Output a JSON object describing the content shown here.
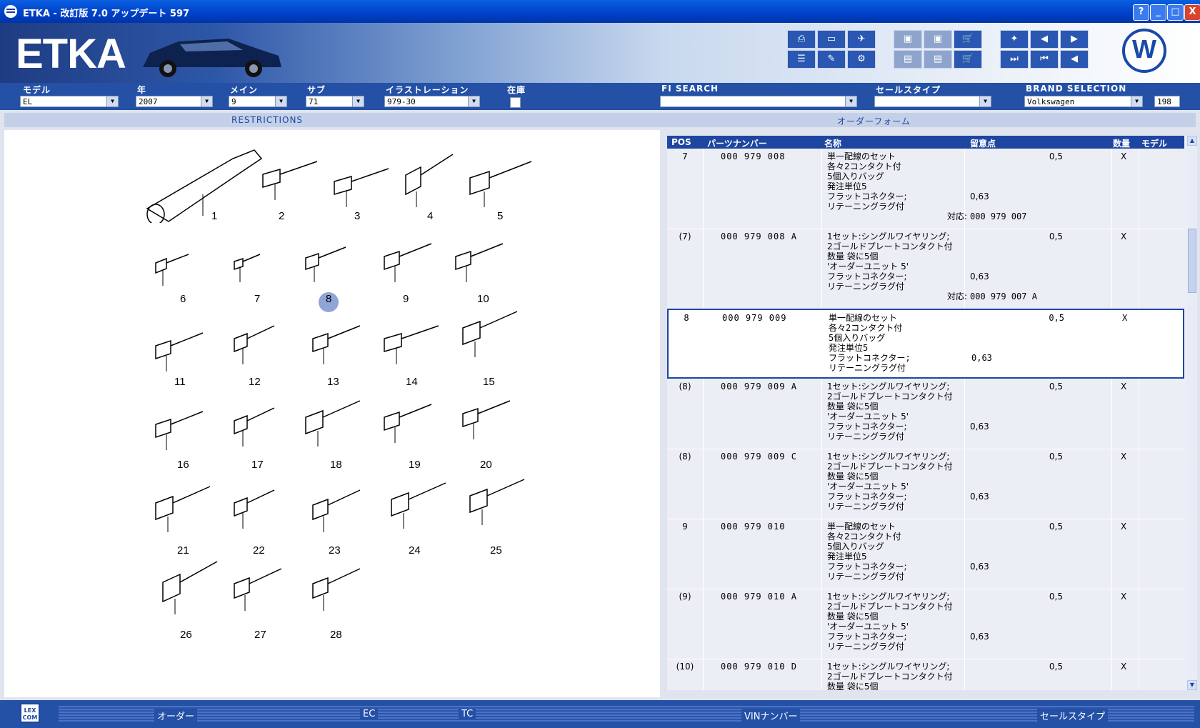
{
  "window": {
    "title": "ETKA - 改訂版 7.0 アップデート 597",
    "help": "?",
    "min": "_",
    "max": "□",
    "close": "X"
  },
  "banner": {
    "logo": "ETKA"
  },
  "filters": {
    "model": {
      "label": "モデル",
      "value": "EL"
    },
    "year": {
      "label": "年",
      "value": "2007"
    },
    "main": {
      "label": "メイン",
      "value": "9"
    },
    "sub": {
      "label": "サブ",
      "value": "71"
    },
    "illustration": {
      "label": "イラストレーション",
      "value": "979-30"
    },
    "stock": {
      "label": "在庫"
    },
    "fi_search": {
      "label": "FI SEARCH",
      "value": ""
    },
    "sales_type": {
      "label": "セールスタイプ",
      "value": ""
    },
    "brand": {
      "label": "BRAND SELECTION",
      "value": "Volkswagen",
      "count": "198"
    }
  },
  "subbar": {
    "restrictions": "RESTRICTIONS",
    "order_form": "オーダーフォーム"
  },
  "illustration": {
    "labels": [
      "1",
      "2",
      "3",
      "4",
      "5",
      "6",
      "7",
      "8",
      "9",
      "10",
      "11",
      "12",
      "13",
      "14",
      "15",
      "16",
      "17",
      "18",
      "19",
      "20",
      "21",
      "22",
      "23",
      "24",
      "25",
      "26",
      "27",
      "28"
    ],
    "highlighted": "8"
  },
  "table": {
    "headers": {
      "pos": "POS",
      "part_number": "パーツナンバー",
      "name": "名称",
      "remarks": "留意点",
      "qty": "数量",
      "model": "モデル"
    },
    "rows": [
      {
        "pos": "7",
        "pn": "000 979 008",
        "name": [
          "単一配線のセット",
          "各々2コンタクト付",
          "5個入りバッグ",
          "発注単位5",
          "フラットコネクター;",
          "リテーニングラグ付"
        ],
        "remark": "0,63",
        "qty": "0,5",
        "model": "X",
        "replace_label": "対応:",
        "replace": "000 979 007"
      },
      {
        "pos": "(7)",
        "pn": "000 979 008 A",
        "name": [
          "1セット:シングルワイヤリング;",
          "2ゴールドプレートコンタクト付",
          "数量 袋に5個",
          "'オーダーユニット 5'",
          "フラットコネクター;",
          "リテーニングラグ付"
        ],
        "remark": "0,63",
        "qty": "0,5",
        "model": "X",
        "replace_label": "対応:",
        "replace": "000 979 007 A"
      },
      {
        "pos": "8",
        "pn": "000 979 009",
        "name": [
          "単一配線のセット",
          "各々2コンタクト付",
          "5個入りバッグ",
          "発注単位5",
          "フラットコネクター;",
          "リテーニングラグ付"
        ],
        "remark": "0,63",
        "qty": "0,5",
        "model": "X"
      },
      {
        "pos": "(8)",
        "pn": "000 979 009 A",
        "name": [
          "1セット:シングルワイヤリング;",
          "2ゴールドプレートコンタクト付",
          "数量 袋に5個",
          "'オーダーユニット 5'",
          "フラットコネクター;",
          "リテーニングラグ付"
        ],
        "remark": "0,63",
        "qty": "0,5",
        "model": "X"
      },
      {
        "pos": "(8)",
        "pn": "000 979 009 C",
        "name": [
          "1セット:シングルワイヤリング;",
          "2ゴールドプレートコンタクト付",
          "数量 袋に5個",
          "'オーダーユニット 5'",
          "フラットコネクター;",
          "リテーニングラグ付"
        ],
        "remark": "0,63",
        "qty": "0,5",
        "model": "X"
      },
      {
        "pos": "9",
        "pn": "000 979 010",
        "name": [
          "単一配線のセット",
          "各々2コンタクト付",
          "5個入りバッグ",
          "発注単位5",
          "フラットコネクター;",
          "リテーニングラグ付"
        ],
        "remark": "0,63",
        "qty": "0,5",
        "model": "X"
      },
      {
        "pos": "(9)",
        "pn": "000 979 010 A",
        "name": [
          "1セット:シングルワイヤリング;",
          "2ゴールドプレートコンタクト付",
          "数量 袋に5個",
          "'オーダーユニット 5'",
          "フラットコネクター;",
          "リテーニングラグ付"
        ],
        "remark": "0,63",
        "qty": "0,5",
        "model": "X"
      },
      {
        "pos": "(10)",
        "pn": "000 979 010 D",
        "name": [
          "1セット:シングルワイヤリング;",
          "2ゴールドプレートコンタクト付",
          "数量 袋に5個"
        ],
        "remark": "",
        "qty": "0,5",
        "model": "X"
      }
    ]
  },
  "bottom": {
    "lexcom": "LEX COM",
    "order": "オーダー",
    "ec": "EC",
    "tc": "TC",
    "vin": "VINナンバー",
    "sales_type": "セールスタイプ"
  },
  "colors": {
    "accent": "#1e46a0",
    "bar": "#2450a6"
  }
}
